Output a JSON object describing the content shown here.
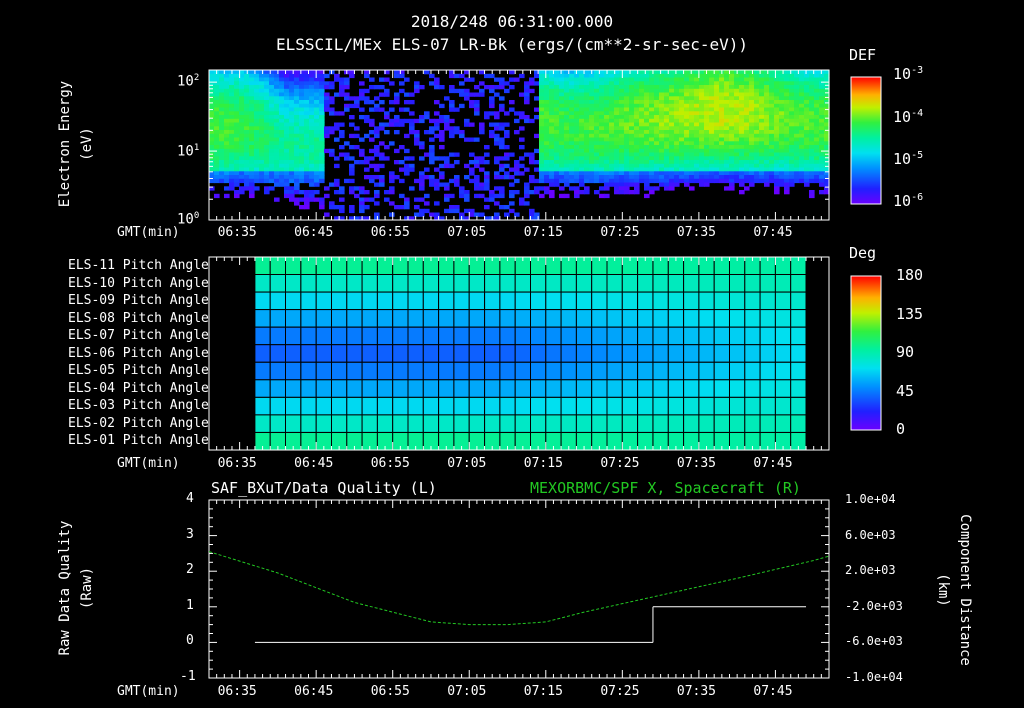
{
  "header": {
    "timestamp": "2018/248 06:31:00.000",
    "subtitle": "ELSSCIL/MEx ELS-07 LR-Bk  (ergs/(cm**2-sr-sec-eV))"
  },
  "colors": {
    "background": "#000000",
    "axis": "#ffffff",
    "component_line": "#22c822",
    "quality_line": "#ffffff",
    "right_label": "#22c822"
  },
  "panel1": {
    "ylabel_line1": "Electron Energy",
    "ylabel_line2": "(eV)",
    "yticks": [
      {
        "base": "10",
        "exp": "2"
      },
      {
        "base": "10",
        "exp": "1"
      },
      {
        "base": "10",
        "exp": "0"
      }
    ],
    "colorbar_title": "DEF",
    "colorbar_ticks": [
      {
        "base": "10",
        "exp": "-3"
      },
      {
        "base": "10",
        "exp": "-4"
      },
      {
        "base": "10",
        "exp": "-5"
      },
      {
        "base": "10",
        "exp": "-6"
      }
    ],
    "gmt_label": "GMT(min)",
    "xticks": [
      "06:35",
      "06:45",
      "06:55",
      "07:05",
      "07:15",
      "07:25",
      "07:35",
      "07:45"
    ]
  },
  "panel2": {
    "row_labels": [
      "ELS-11 Pitch Angle",
      "ELS-10 Pitch Angle",
      "ELS-09 Pitch Angle",
      "ELS-08 Pitch Angle",
      "ELS-07 Pitch Angle",
      "ELS-06 Pitch Angle",
      "ELS-05 Pitch Angle",
      "ELS-04 Pitch Angle",
      "ELS-03 Pitch Angle",
      "ELS-02 Pitch Angle",
      "ELS-01 Pitch Angle"
    ],
    "colorbar_title": "Deg",
    "colorbar_ticks": [
      "180",
      "135",
      "90",
      "45",
      "0"
    ],
    "gmt_label": "GMT(min)",
    "xticks": [
      "06:35",
      "06:45",
      "06:55",
      "07:05",
      "07:15",
      "07:25",
      "07:35",
      "07:45"
    ]
  },
  "panel3": {
    "left_title": "SAF_BXuT/Data Quality (L)",
    "right_title": "MEXORBMC/SPF X, Spacecraft (R)",
    "left_ylabel_line1": "Raw Data Quality",
    "left_ylabel_line2": "(Raw)",
    "right_ylabel_line1": "Component Distance",
    "right_ylabel_line2": "(km)",
    "left_yticks": [
      "4",
      "3",
      "2",
      "1",
      "0",
      "-1"
    ],
    "right_yticks": [
      "1.0e+04",
      "6.0e+03",
      "2.0e+03",
      "-2.0e+03",
      "-6.0e+03",
      "-1.0e+04"
    ],
    "gmt_label": "GMT(min)",
    "xticks": [
      "06:35",
      "06:45",
      "06:55",
      "07:05",
      "07:15",
      "07:25",
      "07:35",
      "07:45"
    ]
  },
  "chart_data": [
    {
      "type": "heatmap",
      "title": "ELSSCIL/MEx ELS-07 LR-Bk  (ergs/(cm**2-sr-sec-eV))",
      "xlabel": "GMT(min)",
      "ylabel": "Electron Energy (eV)",
      "y_scale": "log",
      "ylim": [
        1,
        150
      ],
      "x_ticks": [
        "06:35",
        "06:45",
        "06:55",
        "07:05",
        "07:15",
        "07:25",
        "07:35",
        "07:45"
      ],
      "colorbar": {
        "label": "DEF",
        "scale": "log",
        "range": [
          1e-06,
          0.001
        ]
      },
      "x_times": [
        "06:31",
        "06:36",
        "06:41",
        "06:46",
        "06:51",
        "06:53",
        "06:58",
        "07:01",
        "07:05",
        "07:10",
        "07:14",
        "07:18",
        "07:22",
        "07:26",
        "07:30",
        "07:34",
        "07:38",
        "07:42",
        "07:46",
        "07:50",
        "07:52"
      ],
      "peak_energy_eV": [
        22,
        22,
        12,
        12,
        null,
        null,
        null,
        null,
        null,
        null,
        25,
        22,
        22,
        28,
        30,
        35,
        40,
        35,
        30,
        25,
        25
      ],
      "peak_log10_def": [
        -4.3,
        -4.4,
        -4.8,
        -4.8,
        -6.5,
        -6.5,
        -6.2,
        -6.5,
        -6.5,
        -6.5,
        -4.3,
        -4.4,
        -4.3,
        -4.2,
        -4.1,
        -4.0,
        -3.9,
        -4.0,
        -4.2,
        -4.3,
        -4.3
      ],
      "gap_intervals": [
        [
          "06:51",
          "06:58"
        ],
        [
          "07:00",
          "07:13"
        ]
      ]
    },
    {
      "type": "heatmap",
      "xlabel": "GMT(min)",
      "rows": [
        "ELS-11",
        "ELS-10",
        "ELS-09",
        "ELS-08",
        "ELS-07",
        "ELS-06",
        "ELS-05",
        "ELS-04",
        "ELS-03",
        "ELS-02",
        "ELS-01"
      ],
      "colorbar": {
        "label": "Deg",
        "range": [
          0,
          180
        ],
        "ticks": [
          0,
          45,
          90,
          135,
          180
        ]
      },
      "x_ticks": [
        "06:35",
        "06:45",
        "06:55",
        "07:05",
        "07:15",
        "07:25",
        "07:35",
        "07:45"
      ],
      "data_range": [
        "06:37",
        "07:49"
      ],
      "pitch_angle_start_deg": [
        96,
        83,
        70,
        57,
        45,
        38,
        45,
        57,
        70,
        83,
        96
      ],
      "pitch_angle_end_deg": [
        92,
        88,
        82,
        78,
        74,
        72,
        74,
        78,
        82,
        88,
        92
      ]
    },
    {
      "type": "line",
      "xlabel": "GMT(min)",
      "x_ticks": [
        "06:35",
        "06:45",
        "06:55",
        "07:05",
        "07:15",
        "07:25",
        "07:35",
        "07:45"
      ],
      "series": [
        {
          "name": "SAF_BXuT/Data Quality (L)",
          "axis": "left",
          "ylim": [
            -1,
            4
          ],
          "segments": [
            {
              "x": [
                "06:37",
                "07:29"
              ],
              "y": [
                0,
                0
              ]
            },
            {
              "x": [
                "07:29",
                "07:49"
              ],
              "y": [
                1,
                1
              ]
            }
          ]
        },
        {
          "name": "MEXORBMC/SPF X, Spacecraft (R)",
          "axis": "right",
          "ylim": [
            -10000,
            10000
          ],
          "style": "dashed",
          "x": [
            "06:31",
            "06:40",
            "06:50",
            "07:00",
            "07:05",
            "07:10",
            "07:15",
            "07:20",
            "07:30",
            "07:40",
            "07:50",
            "07:52"
          ],
          "y": [
            4200,
            1800,
            -1500,
            -3700,
            -4000,
            -4000,
            -3700,
            -2600,
            -700,
            1200,
            3200,
            3700
          ]
        }
      ]
    }
  ]
}
